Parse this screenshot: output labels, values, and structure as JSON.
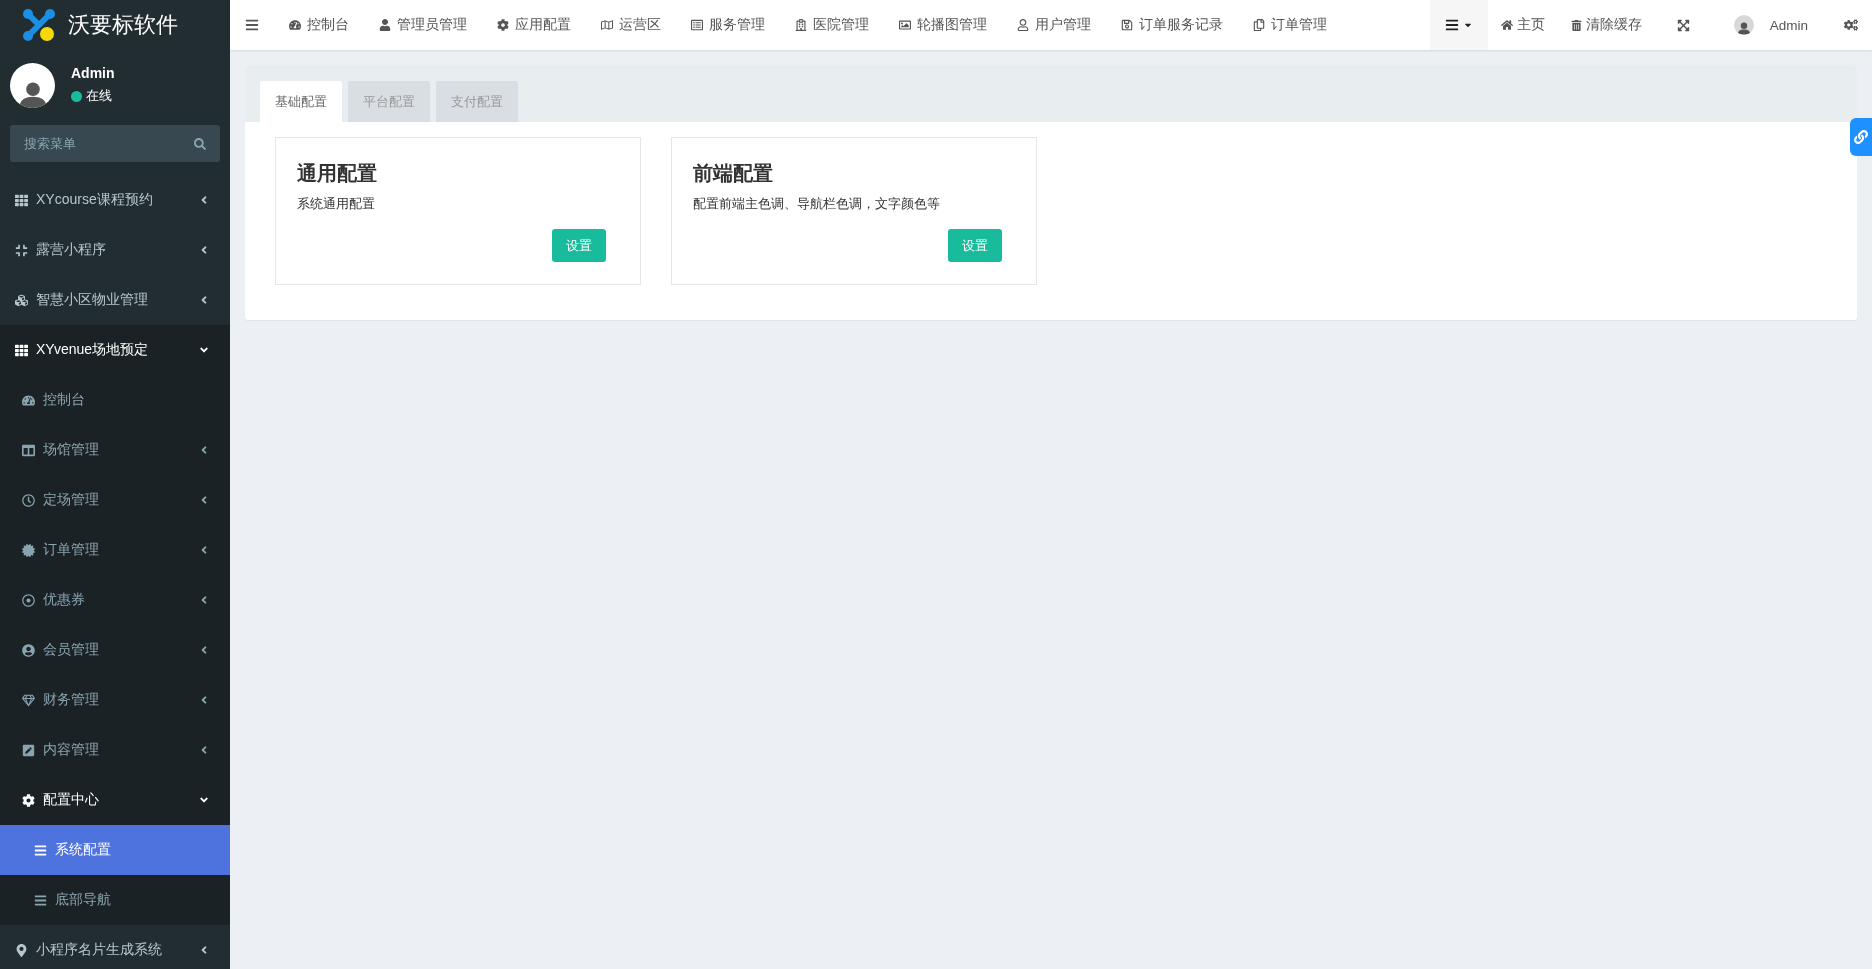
{
  "brand": {
    "name": "沃要标软件"
  },
  "user": {
    "name": "Admin",
    "status": "在线"
  },
  "search": {
    "placeholder": "搜索菜单"
  },
  "menu": [
    {
      "kind": "group",
      "label": "XYcourse课程预约",
      "expanded": false,
      "selected": false
    },
    {
      "kind": "group",
      "label": "露营小程序",
      "expanded": false,
      "selected": false
    },
    {
      "kind": "group",
      "label": "智慧小区物业管理",
      "expanded": false,
      "selected": false
    },
    {
      "kind": "group",
      "label": "XYvenue场地预定",
      "expanded": true,
      "selected": false,
      "children": [
        {
          "kind": "link",
          "label": "控制台",
          "selected": false
        },
        {
          "kind": "group",
          "label": "场馆管理",
          "expanded": false,
          "selected": false
        },
        {
          "kind": "group",
          "label": "定场管理",
          "expanded": false,
          "selected": false
        },
        {
          "kind": "group",
          "label": "订单管理",
          "expanded": false,
          "selected": false
        },
        {
          "kind": "group",
          "label": "优惠券",
          "expanded": false,
          "selected": false
        },
        {
          "kind": "group",
          "label": "会员管理",
          "expanded": false,
          "selected": false
        },
        {
          "kind": "group",
          "label": "财务管理",
          "expanded": false,
          "selected": false
        },
        {
          "kind": "group",
          "label": "内容管理",
          "expanded": false,
          "selected": false
        },
        {
          "kind": "group",
          "label": "配置中心",
          "expanded": true,
          "selected": false,
          "children": [
            {
              "kind": "link",
              "label": "系统配置",
              "selected": true
            },
            {
              "kind": "link",
              "label": "底部导航",
              "selected": false
            }
          ]
        }
      ]
    },
    {
      "kind": "group",
      "label": "小程序名片生成系统",
      "expanded": false,
      "selected": false
    }
  ],
  "nav": [
    {
      "label": "控制台"
    },
    {
      "label": "管理员管理"
    },
    {
      "label": "应用配置"
    },
    {
      "label": "运营区"
    },
    {
      "label": "服务管理"
    },
    {
      "label": "医院管理"
    },
    {
      "label": "轮播图管理"
    },
    {
      "label": "用户管理"
    },
    {
      "label": "订单服务记录"
    },
    {
      "label": "订单管理"
    }
  ],
  "toolbar": [
    {
      "kind": "dropdown"
    },
    {
      "kind": "link",
      "label": "主页"
    },
    {
      "kind": "link",
      "label": "清除缓存"
    },
    {
      "kind": "fullscreen"
    },
    {
      "kind": "user",
      "label": "Admin"
    },
    {
      "kind": "settings"
    }
  ],
  "tabs": [
    {
      "label": "基础配置",
      "selected": true
    },
    {
      "label": "平台配置",
      "selected": false
    },
    {
      "label": "支付配置",
      "selected": false
    }
  ],
  "cards": [
    {
      "title": "通用配置",
      "description": "系统通用配置",
      "button": "设置"
    },
    {
      "title": "前端配置",
      "description": "配置前端主色调、导航栏色调，文字颜色等",
      "button": "设置"
    }
  ]
}
